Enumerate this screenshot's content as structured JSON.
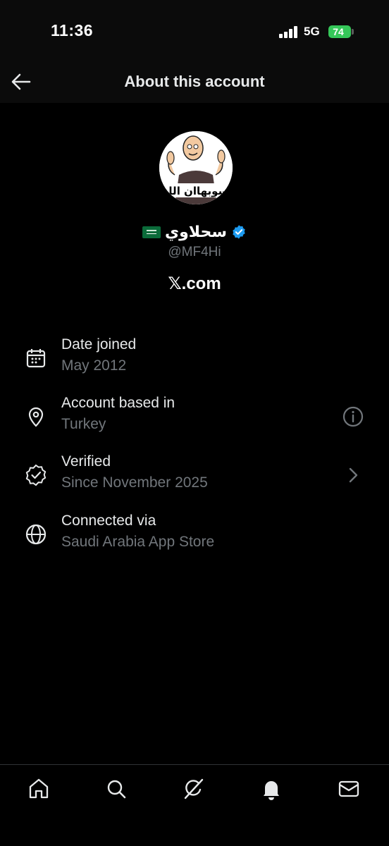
{
  "status_bar": {
    "time": "11:36",
    "network": "5G",
    "battery": "74"
  },
  "header": {
    "title": "About this account",
    "back_icon": "back-arrow-icon"
  },
  "profile": {
    "avatar_caption": "سوبهاان الل",
    "name": "سحلاوي",
    "flag_emoji": "🇸🇦",
    "handle": "@MF4Hi",
    "site": "𝕏.com",
    "verified_color": "#1d9bf0"
  },
  "details": [
    {
      "label": "Date joined",
      "value": "May 2012",
      "icon": "calendar-icon"
    },
    {
      "label": "Account based in",
      "value": "Turkey",
      "icon": "location-pin-icon",
      "action_icon": "info-icon"
    },
    {
      "label": "Verified",
      "value": "Since November 2025",
      "icon": "verified-badge-icon",
      "action_icon": "chevron-right-icon"
    },
    {
      "label": "Connected via",
      "value": "Saudi Arabia App Store",
      "icon": "globe-icon"
    }
  ],
  "tab_bar": [
    "home-icon",
    "search-icon",
    "grok-icon",
    "notifications-icon",
    "messages-icon"
  ],
  "colors": {
    "background": "#000000",
    "secondary_text": "#71767b",
    "battery": "#35c759"
  }
}
